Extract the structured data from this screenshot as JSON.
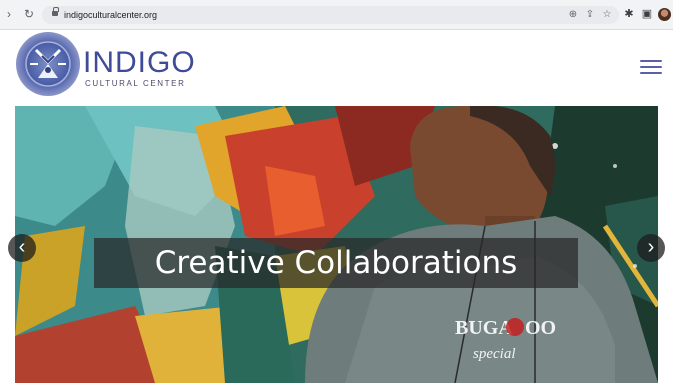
{
  "browser": {
    "url": "indigoculturalcenter.org",
    "icons": [
      "back-icon",
      "reload-icon",
      "lock-icon",
      "zoom-icon",
      "share-icon",
      "star-icon",
      "extensions-icon",
      "sidebar-icon",
      "profile-avatar"
    ]
  },
  "site": {
    "brand_name": "INDIGO",
    "brand_sub": "CULTURAL CENTER",
    "brand_color": "#3f4b98",
    "menu_icon": "hamburger-icon"
  },
  "hero": {
    "caption": "Creative Collaborations",
    "prev_icon": "chevron-left-icon",
    "next_icon": "chevron-right-icon",
    "prev_glyph": "‹",
    "next_glyph": "›"
  }
}
